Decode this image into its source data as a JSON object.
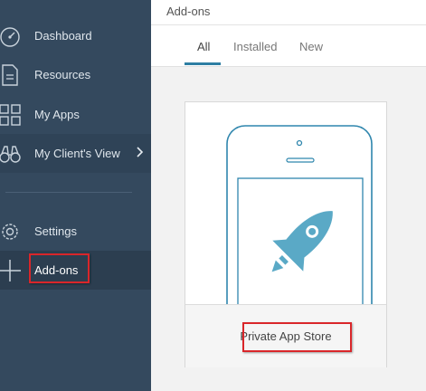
{
  "sidebar": {
    "items": [
      {
        "label": "Dashboard",
        "icon": "gauge-icon"
      },
      {
        "label": "Resources",
        "icon": "document-icon"
      },
      {
        "label": "My Apps",
        "icon": "apps-grid-icon"
      },
      {
        "label": "My Client's View",
        "icon": "binoculars-icon"
      },
      {
        "label": "Settings",
        "icon": "gear-icon"
      },
      {
        "label": "Add-ons",
        "icon": "plus-icon"
      }
    ]
  },
  "header": {
    "title": "Add-ons"
  },
  "tabs": [
    {
      "label": "All",
      "active": true
    },
    {
      "label": "Installed"
    },
    {
      "label": "New"
    }
  ],
  "card": {
    "title": "Private App Store",
    "image_icon": "rocket-icon"
  },
  "colors": {
    "sidebar_bg": "#34495e",
    "accent": "#2e7ea3",
    "highlight_border": "#d9262a"
  }
}
